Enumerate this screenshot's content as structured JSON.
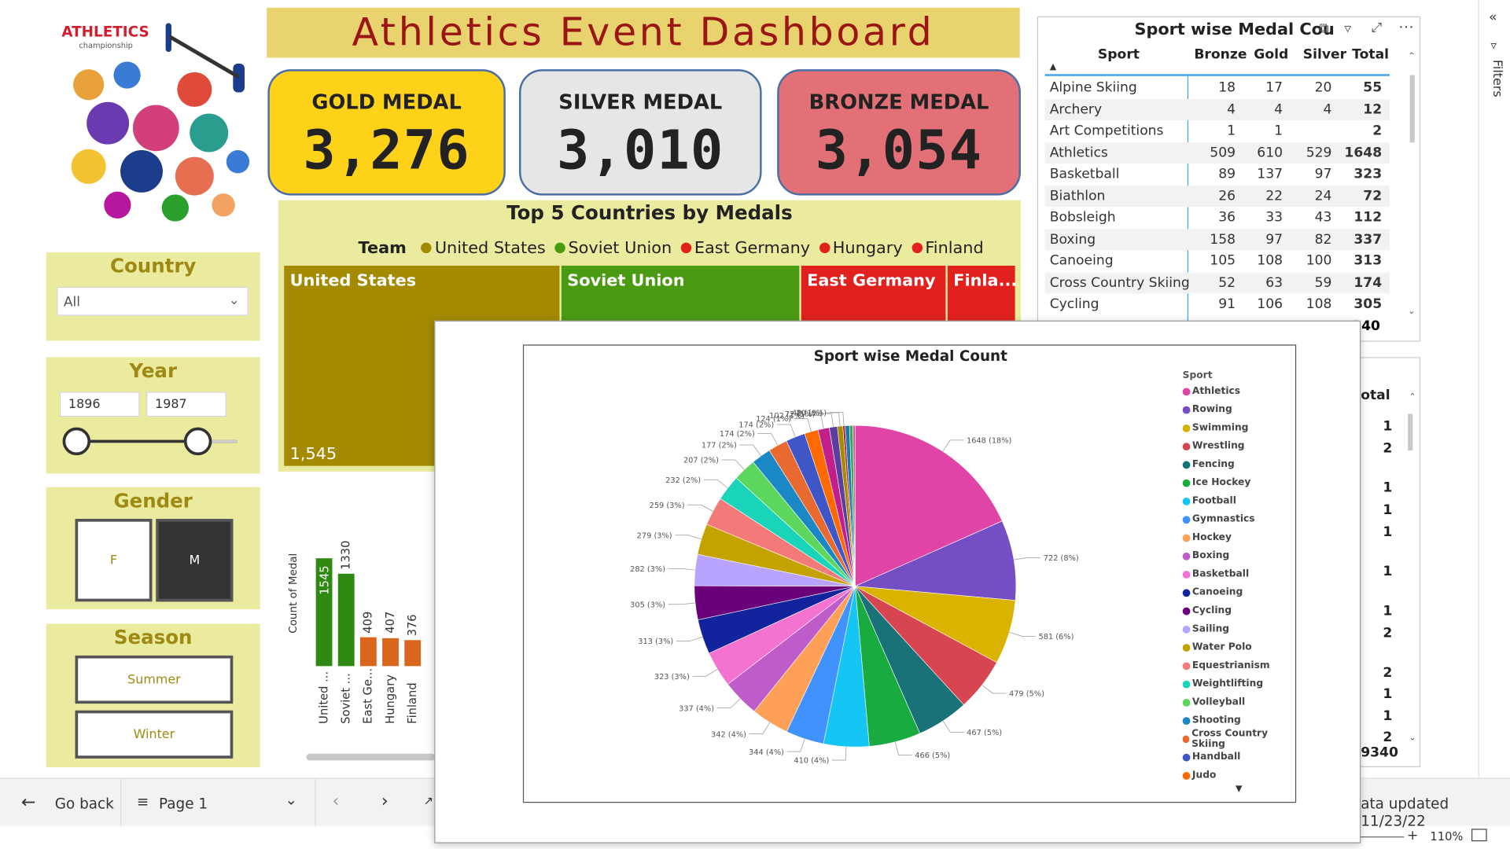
{
  "header": {
    "title": "Athletics Event  Dashboard"
  },
  "logo": {
    "text": "ATHLETICS",
    "subtext": "championship"
  },
  "cards": {
    "gold": {
      "label": "GOLD MEDAL",
      "value": "3,276",
      "color": "#ffd21a"
    },
    "silver": {
      "label": "SILVER MEDAL",
      "value": "3,010",
      "color": "#e6e6e6"
    },
    "bronze": {
      "label": "BRONZE MEDAL",
      "value": "3,054",
      "color": "#e27076"
    }
  },
  "slicers": {
    "country": {
      "title": "Country",
      "value": "All"
    },
    "year": {
      "title": "Year",
      "from": "1896",
      "to": "1987"
    },
    "gender": {
      "title": "Gender",
      "options": [
        "F",
        "M"
      ],
      "selected": "M"
    },
    "season": {
      "title": "Season",
      "options": [
        "Summer",
        "Winter"
      ]
    }
  },
  "treemap": {
    "title": "Top 5 Countries by Medals",
    "legend_title": "Team",
    "legend": [
      {
        "name": "United States",
        "color": "#a38a00"
      },
      {
        "name": "Soviet Union",
        "color": "#4a9a12"
      },
      {
        "name": "East Germany",
        "color": "#e0211d"
      },
      {
        "name": "Hungary",
        "color": "#e0211d"
      },
      {
        "name": "Finland",
        "color": "#e0211d"
      }
    ],
    "tiles": [
      {
        "name": "United States",
        "value": "1,545",
        "color": "#a38a00"
      },
      {
        "name": "Soviet Union",
        "color": "#4a9a12"
      },
      {
        "name": "East Germany",
        "color": "#e0211d"
      },
      {
        "name": "Finla...",
        "color": "#e0211d"
      }
    ]
  },
  "barchart": {
    "ylabel": "Count of Medal",
    "bars": [
      {
        "label": "United ...",
        "value": 1545,
        "color": "#2f8a13"
      },
      {
        "label": "Soviet ...",
        "value": 1330,
        "color": "#2f8a13"
      },
      {
        "label": "East Ge...",
        "value": 409,
        "color": "#d9661c"
      },
      {
        "label": "Hungary",
        "value": 407,
        "color": "#d9661c"
      },
      {
        "label": "Finland",
        "value": 376,
        "color": "#d9661c"
      }
    ]
  },
  "table": {
    "title": "Sport wise Medal Cou",
    "columns": [
      "Sport",
      "Bronze",
      "Gold",
      "Silver",
      "Total"
    ],
    "rows": [
      [
        "Alpine Skiing",
        "18",
        "17",
        "20",
        "55"
      ],
      [
        "Archery",
        "4",
        "4",
        "4",
        "12"
      ],
      [
        "Art Competitions",
        "1",
        "1",
        "",
        "2"
      ],
      [
        "Athletics",
        "509",
        "610",
        "529",
        "1648"
      ],
      [
        "Basketball",
        "89",
        "137",
        "97",
        "323"
      ],
      [
        "Biathlon",
        "26",
        "22",
        "24",
        "72"
      ],
      [
        "Bobsleigh",
        "36",
        "33",
        "43",
        "112"
      ],
      [
        "Boxing",
        "158",
        "97",
        "82",
        "337"
      ],
      [
        "Canoeing",
        "105",
        "108",
        "100",
        "313"
      ],
      [
        "Cross Country Skiing",
        "52",
        "63",
        "59",
        "174"
      ],
      [
        "Cycling",
        "91",
        "106",
        "108",
        "305"
      ]
    ],
    "total_partial": "340"
  },
  "table2": {
    "header": "otal",
    "values": [
      "1",
      "2",
      "1",
      "1",
      "1",
      "1",
      "1",
      "2",
      "2",
      "1",
      "1",
      "2"
    ],
    "total_partial": "9340"
  },
  "bottom": {
    "go_back": "Go back",
    "page": "Page 1",
    "updated": "ata updated 11/23/22",
    "zoom": "110%"
  },
  "filters_label": "Filters",
  "chart_data": {
    "type": "pie",
    "title": "Sport wise Medal Count",
    "legend_title": "Sport",
    "slices": [
      {
        "name": "Athletics",
        "value": 1648,
        "label": "1648 (18%)",
        "color": "#e044a7"
      },
      {
        "name": "Rowing",
        "value": 722,
        "label": "722 (8%)",
        "color": "#744ec2"
      },
      {
        "name": "Swimming",
        "value": 581,
        "label": "581 (6%)",
        "color": "#d9b300"
      },
      {
        "name": "Wrestling",
        "value": 479,
        "label": "479 (5%)",
        "color": "#d64550"
      },
      {
        "name": "Fencing",
        "value": 467,
        "label": "467 (5%)",
        "color": "#197278"
      },
      {
        "name": "Ice Hockey",
        "value": 466,
        "label": "466 (5%)",
        "color": "#1aab40"
      },
      {
        "name": "Football",
        "value": 410,
        "label": "410 (4%)",
        "color": "#15c6f4"
      },
      {
        "name": "Gymnastics",
        "value": 344,
        "label": "344 (4%)",
        "color": "#4092ff"
      },
      {
        "name": "Hockey",
        "value": 342,
        "label": "342 (4%)",
        "color": "#ffa058"
      },
      {
        "name": "Boxing",
        "value": 337,
        "label": "337 (4%)",
        "color": "#be5dc9"
      },
      {
        "name": "Basketball",
        "value": 323,
        "label": "323 (3%)",
        "color": "#f472d0"
      },
      {
        "name": "Canoeing",
        "value": 313,
        "label": "313 (3%)",
        "color": "#12239e"
      },
      {
        "name": "Cycling",
        "value": 305,
        "label": "305 (3%)",
        "color": "#6b007b"
      },
      {
        "name": "Sailing",
        "value": 282,
        "label": "282 (3%)",
        "color": "#b8a3ff"
      },
      {
        "name": "Water Polo",
        "value": 279,
        "label": "279 (3%)",
        "color": "#c4a200"
      },
      {
        "name": "Equestrianism",
        "value": 259,
        "label": "259 (3%)",
        "color": "#f47a7a"
      },
      {
        "name": "Weightlifting",
        "value": 232,
        "label": "232 (2%)",
        "color": "#19d4b8"
      },
      {
        "name": "Volleyball",
        "value": 207,
        "label": "207 (2%)",
        "color": "#5cd65c"
      },
      {
        "name": "Shooting",
        "value": 177,
        "label": "177 (2%)",
        "color": "#1988c4"
      },
      {
        "name": "Cross Country Skiing",
        "value": 174,
        "label": "174 (2%)",
        "color": "#e86a31"
      },
      {
        "name": "Handball",
        "value": 174,
        "label": "174 (2%)",
        "color": "#3f56c6"
      },
      {
        "name": "Judo",
        "value": 124,
        "label": "124 (1%)",
        "color": "#ff6a00"
      },
      {
        "name": "",
        "value": 102,
        "label": "102 (1%)",
        "color": "#c21f8a"
      },
      {
        "name": "",
        "value": 72,
        "label": "72 (1%)",
        "color": "#5b3fa0"
      },
      {
        "name": "",
        "value": 49,
        "label": "49 (1%)",
        "color": "#a68a00"
      },
      {
        "name": "",
        "value": 20,
        "label": "20 (0%)",
        "color": "#aa2233"
      },
      {
        "name": "",
        "value": 40,
        "label": "",
        "color": "#2277aa"
      },
      {
        "name": "",
        "value": 30,
        "label": "",
        "color": "#33aa55"
      },
      {
        "name": "",
        "value": 20,
        "label": "",
        "color": "#dd5599"
      }
    ]
  }
}
